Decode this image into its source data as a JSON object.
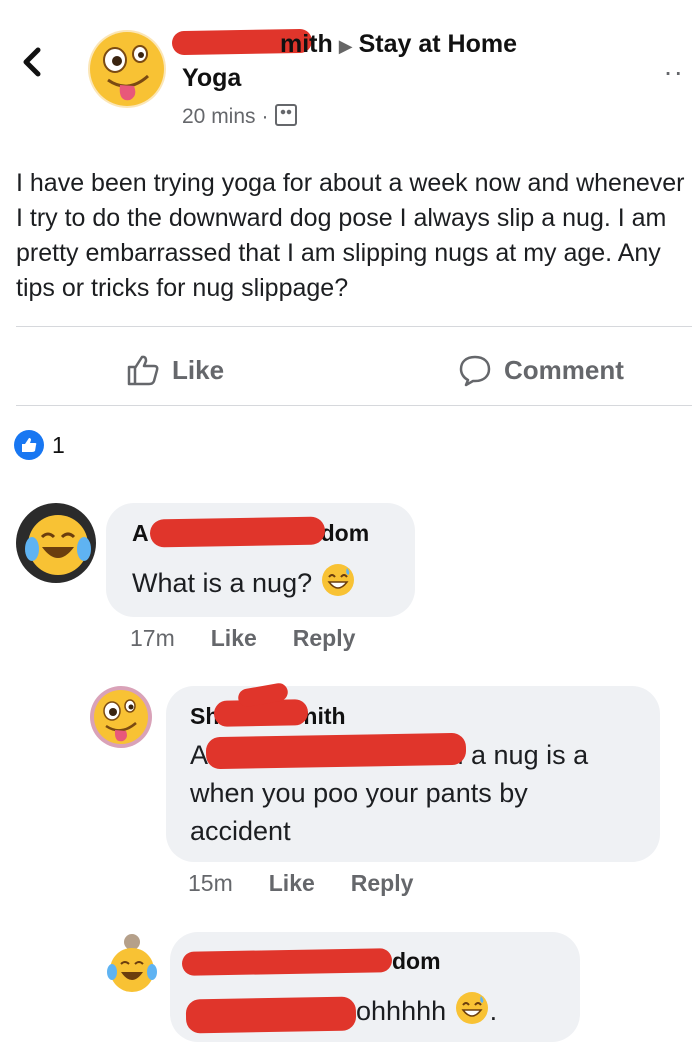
{
  "header": {
    "back_icon": "chevron-left-icon",
    "author_name_visible": "mith",
    "group_name": "Stay at Home",
    "group_name_line2": "Yoga",
    "timestamp": "20 mins",
    "audience_icon": "group-icon",
    "more_icon": "more-dots-icon"
  },
  "post": {
    "text": "I have been trying yoga for about a week now and whenever I try to do the downward dog pose I always slip a nug. I am pretty embarrassed that I am slipping nugs at my age. Any tips or tricks for nug slippage?"
  },
  "actions": {
    "like_label": "Like",
    "comment_label": "Comment"
  },
  "reactions": {
    "count": "1"
  },
  "comments": [
    {
      "name_start": "A",
      "name_end": "dom",
      "text": "What is a nug?",
      "time": "17m",
      "like": "Like",
      "reply": "Reply"
    },
    {
      "name_start": "Sh",
      "name_end": "nith",
      "text_line1_start": "A",
      "text_line1_end": "om a nug is a",
      "text_rest": "when you poo your pants by accident",
      "time": "15m",
      "like": "Like",
      "reply": "Reply"
    },
    {
      "name_end": "dom",
      "text_end": "ith ohhhhh",
      "text_trailing": "."
    }
  ],
  "colors": {
    "redaction": "#e0352b",
    "like_blue": "#1877f2",
    "bubble_bg": "#eff1f4",
    "muted_text": "#65676b"
  }
}
